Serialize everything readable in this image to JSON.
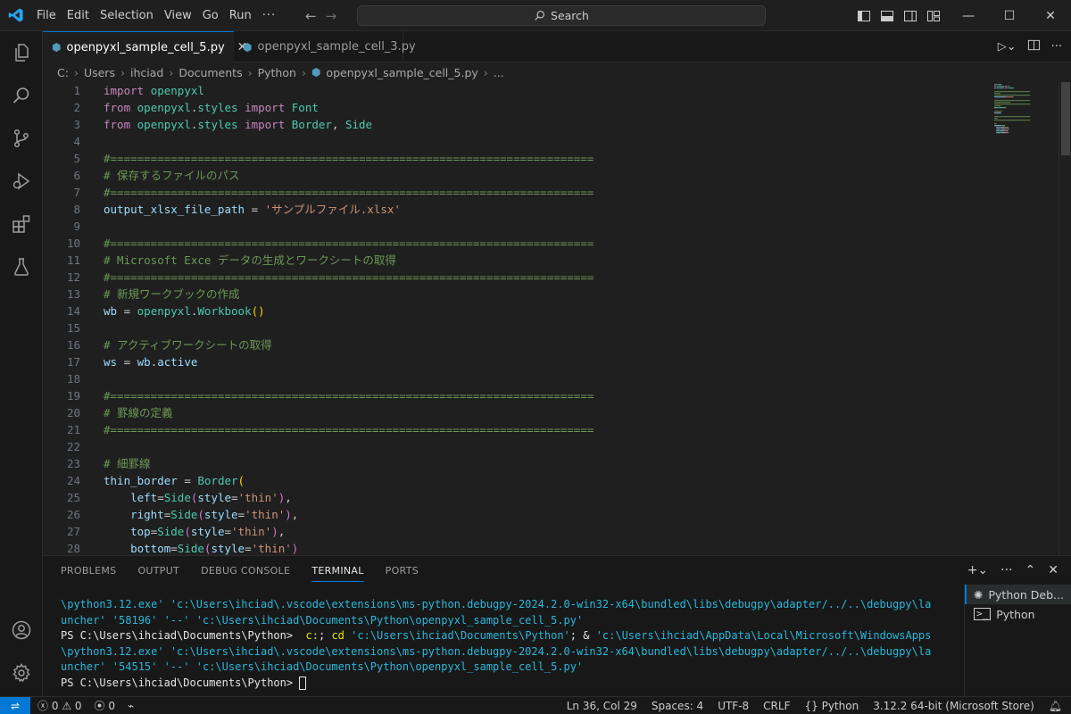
{
  "titlebar": {
    "menu": [
      "File",
      "Edit",
      "Selection",
      "View",
      "Go",
      "Run",
      "···"
    ],
    "search_label": "Search"
  },
  "tabs": [
    {
      "label": "openpyxl_sample_cell_5.py",
      "active": true
    },
    {
      "label": "openpyxl_sample_cell_3.py",
      "active": false
    }
  ],
  "breadcrumb": [
    "C:",
    "Users",
    "ihciad",
    "Documents",
    "Python",
    "openpyxl_sample_cell_5.py",
    "..."
  ],
  "editor": {
    "lines": [
      {
        "n": "1",
        "segs": [
          [
            "kw",
            "import"
          ],
          [
            "op",
            " "
          ],
          [
            "mod",
            "openpyxl"
          ]
        ]
      },
      {
        "n": "2",
        "segs": [
          [
            "kw",
            "from"
          ],
          [
            "op",
            " "
          ],
          [
            "mod",
            "openpyxl"
          ],
          [
            "op",
            "."
          ],
          [
            "mod",
            "styles"
          ],
          [
            "op",
            " "
          ],
          [
            "kw",
            "import"
          ],
          [
            "op",
            " "
          ],
          [
            "mod",
            "Font"
          ]
        ]
      },
      {
        "n": "3",
        "segs": [
          [
            "kw",
            "from"
          ],
          [
            "op",
            " "
          ],
          [
            "mod",
            "openpyxl"
          ],
          [
            "op",
            "."
          ],
          [
            "mod",
            "styles"
          ],
          [
            "op",
            " "
          ],
          [
            "kw",
            "import"
          ],
          [
            "op",
            " "
          ],
          [
            "mod",
            "Border"
          ],
          [
            "op",
            ", "
          ],
          [
            "mod",
            "Side"
          ]
        ]
      },
      {
        "n": "4",
        "segs": []
      },
      {
        "n": "5",
        "segs": [
          [
            "cm",
            "#========================================================================"
          ]
        ]
      },
      {
        "n": "6",
        "segs": [
          [
            "cm",
            "# 保存するファイルのパス"
          ]
        ]
      },
      {
        "n": "7",
        "segs": [
          [
            "cm",
            "#========================================================================"
          ]
        ]
      },
      {
        "n": "8",
        "segs": [
          [
            "id",
            "output_xlsx_file_path"
          ],
          [
            "op",
            " = "
          ],
          [
            "str",
            "'サンプルファイル.xlsx'"
          ]
        ]
      },
      {
        "n": "9",
        "segs": []
      },
      {
        "n": "10",
        "segs": [
          [
            "cm",
            "#========================================================================"
          ]
        ]
      },
      {
        "n": "11",
        "segs": [
          [
            "cm",
            "# Microsoft Exce データの生成とワークシートの取得"
          ]
        ]
      },
      {
        "n": "12",
        "segs": [
          [
            "cm",
            "#========================================================================"
          ]
        ]
      },
      {
        "n": "13",
        "segs": [
          [
            "cm",
            "# 新規ワークブックの作成"
          ]
        ]
      },
      {
        "n": "14",
        "segs": [
          [
            "id",
            "wb"
          ],
          [
            "op",
            " = "
          ],
          [
            "mod",
            "openpyxl"
          ],
          [
            "op",
            "."
          ],
          [
            "mod",
            "Workbook"
          ],
          [
            "br",
            "()"
          ]
        ]
      },
      {
        "n": "15",
        "segs": []
      },
      {
        "n": "16",
        "segs": [
          [
            "cm",
            "# アクティブワークシートの取得"
          ]
        ]
      },
      {
        "n": "17",
        "segs": [
          [
            "id",
            "ws"
          ],
          [
            "op",
            " = "
          ],
          [
            "id",
            "wb"
          ],
          [
            "op",
            "."
          ],
          [
            "id",
            "active"
          ]
        ]
      },
      {
        "n": "18",
        "segs": []
      },
      {
        "n": "19",
        "segs": [
          [
            "cm",
            "#========================================================================"
          ]
        ]
      },
      {
        "n": "20",
        "segs": [
          [
            "cm",
            "# 罫線の定義"
          ]
        ]
      },
      {
        "n": "21",
        "segs": [
          [
            "cm",
            "#========================================================================"
          ]
        ]
      },
      {
        "n": "22",
        "segs": []
      },
      {
        "n": "23",
        "segs": [
          [
            "cm",
            "# 細罫線"
          ]
        ]
      },
      {
        "n": "24",
        "segs": [
          [
            "id",
            "thin_border"
          ],
          [
            "op",
            " = "
          ],
          [
            "mod",
            "Border"
          ],
          [
            "br",
            "("
          ]
        ]
      },
      {
        "n": "25",
        "segs": [
          [
            "op",
            "    "
          ],
          [
            "id",
            "left"
          ],
          [
            "op",
            "="
          ],
          [
            "mod",
            "Side"
          ],
          [
            "br2",
            "("
          ],
          [
            "id",
            "style"
          ],
          [
            "op",
            "="
          ],
          [
            "str",
            "'thin'"
          ],
          [
            "br2",
            ")"
          ],
          [
            "op",
            ","
          ]
        ]
      },
      {
        "n": "26",
        "segs": [
          [
            "op",
            "    "
          ],
          [
            "id",
            "right"
          ],
          [
            "op",
            "="
          ],
          [
            "mod",
            "Side"
          ],
          [
            "br2",
            "("
          ],
          [
            "id",
            "style"
          ],
          [
            "op",
            "="
          ],
          [
            "str",
            "'thin'"
          ],
          [
            "br2",
            ")"
          ],
          [
            "op",
            ","
          ]
        ]
      },
      {
        "n": "27",
        "segs": [
          [
            "op",
            "    "
          ],
          [
            "id",
            "top"
          ],
          [
            "op",
            "="
          ],
          [
            "mod",
            "Side"
          ],
          [
            "br2",
            "("
          ],
          [
            "id",
            "style"
          ],
          [
            "op",
            "="
          ],
          [
            "str",
            "'thin'"
          ],
          [
            "br2",
            ")"
          ],
          [
            "op",
            ","
          ]
        ]
      },
      {
        "n": "28",
        "segs": [
          [
            "op",
            "    "
          ],
          [
            "id",
            "bottom"
          ],
          [
            "op",
            "="
          ],
          [
            "mod",
            "Side"
          ],
          [
            "br2",
            "("
          ],
          [
            "id",
            "style"
          ],
          [
            "op",
            "="
          ],
          [
            "str",
            "'thin'"
          ],
          [
            "br2",
            ")"
          ]
        ]
      }
    ]
  },
  "panel": {
    "tabs": [
      "PROBLEMS",
      "OUTPUT",
      "DEBUG CONSOLE",
      "TERMINAL",
      "PORTS"
    ],
    "active_tab": "TERMINAL",
    "terminal_lines": [
      [
        [
          "tcyan",
          "\\python3.12.exe' 'c:\\Users\\ihciad\\.vscode\\extensions\\ms-python.debugpy-2024.2.0-win32-x64\\bundled\\libs\\debugpy\\adapter/../..\\debugpy\\la"
        ]
      ],
      [
        [
          "tcyan",
          "uncher' '58196' '--' 'c:\\Users\\ihciad\\Documents\\Python\\openpyxl_sample_cell_5.py'"
        ]
      ],
      [
        [
          "twhite",
          "PS C:\\Users\\ihciad\\Documents\\Python> "
        ],
        [
          "tyel",
          " c:"
        ],
        [
          "twhite",
          "; "
        ],
        [
          "tyel",
          "cd"
        ],
        [
          "twhite",
          " "
        ],
        [
          "tcyan",
          "'c:\\Users\\ihciad\\Documents\\Python'"
        ],
        [
          "twhite",
          "; & "
        ],
        [
          "tcyan",
          "'c:\\Users\\ihciad\\AppData\\Local\\Microsoft\\WindowsApps"
        ]
      ],
      [
        [
          "tcyan",
          "\\python3.12.exe' 'c:\\Users\\ihciad\\.vscode\\extensions\\ms-python.debugpy-2024.2.0-win32-x64\\bundled\\libs\\debugpy\\adapter/../..\\debugpy\\la"
        ]
      ],
      [
        [
          "tcyan",
          "uncher' '54515' '--' 'c:\\Users\\ihciad\\Documents\\Python\\openpyxl_sample_cell_5.py'"
        ]
      ],
      [
        [
          "twhite",
          "PS C:\\Users\\ihciad\\Documents\\Python> "
        ]
      ]
    ],
    "terminal_list": [
      "Python Deb...",
      "Python"
    ]
  },
  "statusbar": {
    "errors": "0",
    "warnings": "0",
    "ports": "0",
    "position": "Ln 36, Col 29",
    "spaces": "Spaces: 4",
    "encoding": "UTF-8",
    "eol": "CRLF",
    "language": "Python",
    "interpreter": "3.12.2 64-bit (Microsoft Store)"
  }
}
